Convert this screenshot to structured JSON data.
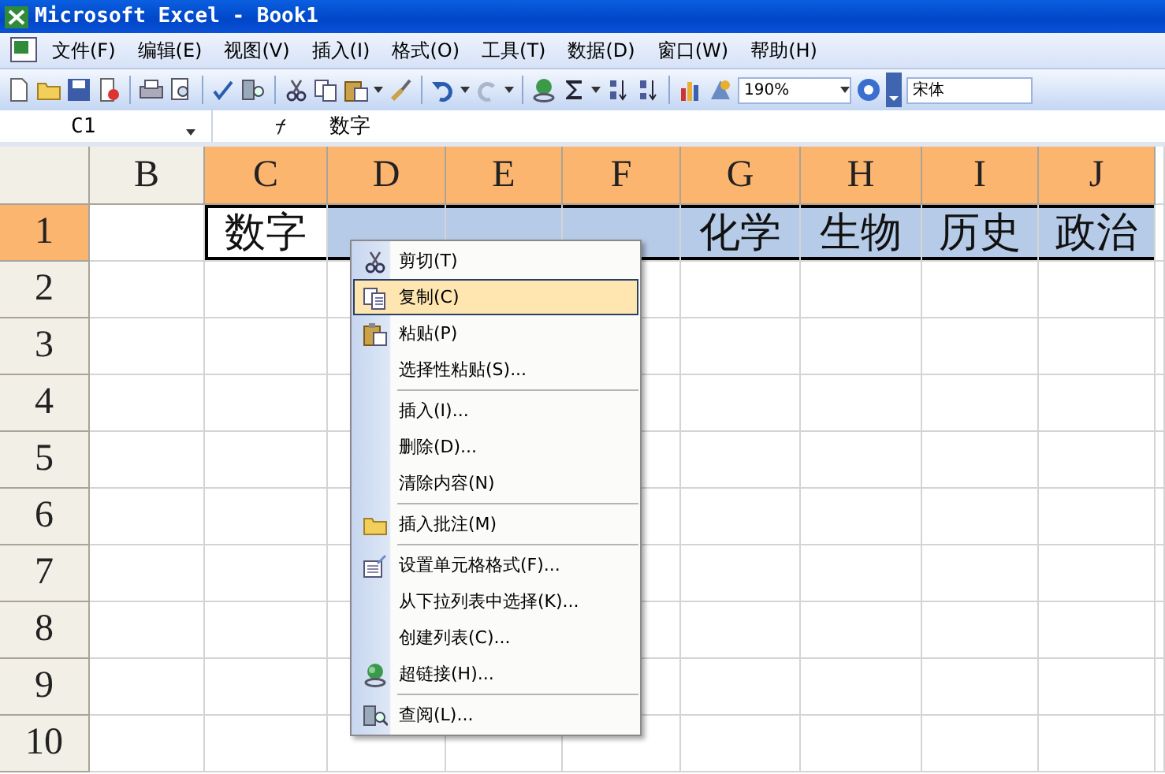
{
  "window": {
    "title": "Microsoft Excel - Book1"
  },
  "menu_bar": [
    "文件(F)",
    "编辑(E)",
    "视图(V)",
    "插入(I)",
    "格式(O)",
    "工具(T)",
    "数据(D)",
    "窗口(W)",
    "帮助(H)"
  ],
  "toolbar": {
    "zoom": "190%",
    "font": "宋体"
  },
  "formula_bar": {
    "name_box": "C1",
    "formula": "数字"
  },
  "columns": [
    {
      "label": "B",
      "selected": false
    },
    {
      "label": "C",
      "selected": true
    },
    {
      "label": "D",
      "selected": true
    },
    {
      "label": "E",
      "selected": true
    },
    {
      "label": "F",
      "selected": true
    },
    {
      "label": "G",
      "selected": true
    },
    {
      "label": "H",
      "selected": true
    },
    {
      "label": "I",
      "selected": true
    },
    {
      "label": "J",
      "selected": true
    }
  ],
  "rows": [
    {
      "label": "1",
      "selected": true,
      "cells": [
        {
          "selected": false,
          "active": false
        },
        {
          "value": "数字",
          "selected": true,
          "active": true
        },
        {
          "selected": true,
          "active": false
        },
        {
          "selected": true,
          "active": false
        },
        {
          "selected": true,
          "active": false
        },
        {
          "value": "化学",
          "selected": true,
          "active": false
        },
        {
          "value": "生物",
          "selected": true,
          "active": false
        },
        {
          "value": "历史",
          "selected": true,
          "active": false
        },
        {
          "value": "政治",
          "selected": true,
          "active": false
        }
      ]
    },
    {
      "label": "2",
      "selected": false
    },
    {
      "label": "3",
      "selected": false
    },
    {
      "label": "4",
      "selected": false
    },
    {
      "label": "5",
      "selected": false
    },
    {
      "label": "6",
      "selected": false
    },
    {
      "label": "7",
      "selected": false
    },
    {
      "label": "8",
      "selected": false
    },
    {
      "label": "9",
      "selected": false
    },
    {
      "label": "10",
      "selected": false
    }
  ],
  "context_menu": {
    "groups": [
      [
        {
          "label": "剪切(T)",
          "selected": false
        },
        {
          "label": "复制(C)",
          "selected": true
        },
        {
          "label": "粘贴(P)",
          "selected": false
        },
        {
          "label": "选择性粘贴(S)...",
          "selected": false
        }
      ],
      [
        {
          "label": "插入(I)...",
          "selected": false
        },
        {
          "label": "删除(D)...",
          "selected": false
        },
        {
          "label": "清除内容(N)",
          "selected": false
        }
      ],
      [
        {
          "label": "插入批注(M)",
          "selected": false
        }
      ],
      [
        {
          "label": "设置单元格格式(F)...",
          "selected": false
        },
        {
          "label": "从下拉列表中选择(K)...",
          "selected": false
        },
        {
          "label": "创建列表(C)...",
          "selected": false
        },
        {
          "label": "超链接(H)...",
          "selected": false
        }
      ],
      [
        {
          "label": "查阅(L)...",
          "selected": false
        }
      ]
    ]
  }
}
